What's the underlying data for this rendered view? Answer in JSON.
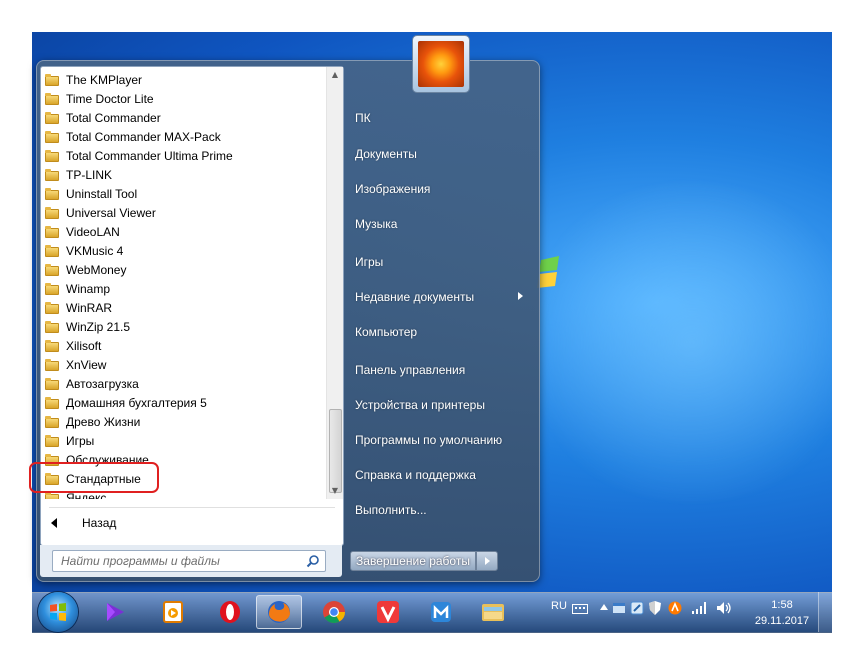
{
  "programs": [
    "The KMPlayer",
    "Time Doctor Lite",
    "Total Commander",
    "Total Commander MAX-Pack",
    "Total Commander Ultima Prime",
    "TP-LINK",
    "Uninstall Tool",
    "Universal Viewer",
    "VideoLAN",
    "VKMusic 4",
    "WebMoney",
    "Winamp",
    "WinRAR",
    "WinZip 21.5",
    "Xilisoft",
    "XnView",
    "Автозагрузка",
    "Домашняя бухгалтерия 5",
    "Древо Жизни",
    "Игры",
    "Обслуживание",
    "Стандартные",
    "Яндекс"
  ],
  "back_label": "Назад",
  "search": {
    "placeholder": "Найти программы и файлы"
  },
  "right_items": {
    "pc": "ПК",
    "documents": "Документы",
    "pictures": "Изображения",
    "music": "Музыка",
    "games": "Игры",
    "recent": "Недавние документы",
    "computer": "Компьютер",
    "control_panel": "Панель управления",
    "devices": "Устройства и принтеры",
    "default_programs": "Программы по умолчанию",
    "help": "Справка и поддержка",
    "run": "Выполнить..."
  },
  "shutdown_label": "Завершение работы",
  "taskbar_apps": [
    "media-player-icon",
    "video-icon",
    "opera-icon",
    "firefox-icon",
    "chrome-icon",
    "vivaldi-icon",
    "maxthon-icon",
    "explorer-icon"
  ],
  "tray": {
    "language": "RU",
    "time": "1:58",
    "date": "29.11.2017"
  },
  "colors": {
    "highlight": "#e02020",
    "desktop": "#1f7fe0"
  }
}
